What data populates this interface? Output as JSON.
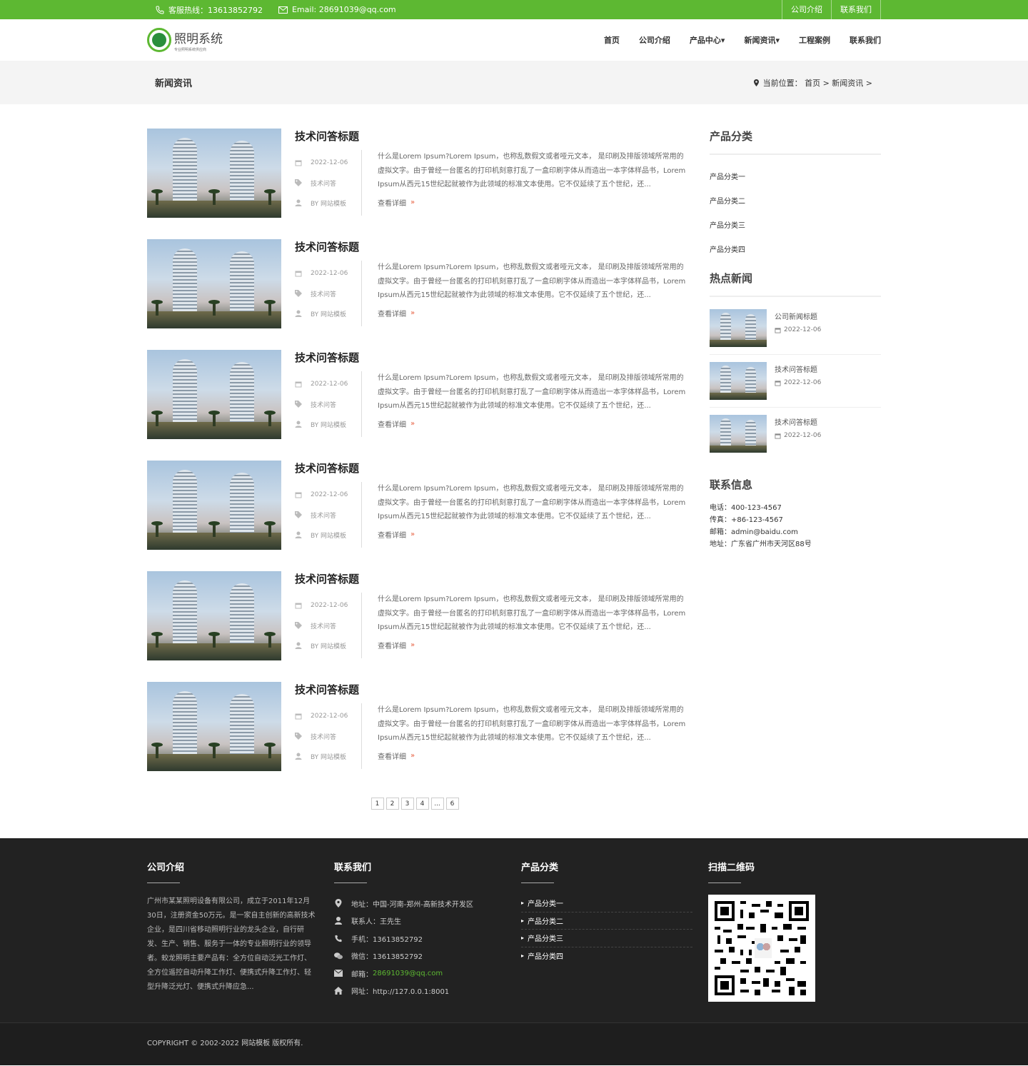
{
  "topbar": {
    "hotline": "客服热线：13613852792",
    "email": "Email: 28691039@qq.com",
    "links": [
      "公司介绍",
      "联系我们"
    ]
  },
  "header": {
    "logo_title": "照明系统",
    "logo_sub": "专业照明系统供应商",
    "nav": [
      "首页",
      "公司介绍",
      "产品中心▾",
      "新闻资讯▾",
      "工程案例",
      "联系我们"
    ]
  },
  "banner": {
    "title": "新闻资讯",
    "crumb": "当前位置： 首页 > 新闻资讯 >"
  },
  "articles": [
    {
      "title": "技术问答标题",
      "date": "2022-12-06",
      "tag": "技术问答",
      "author": "BY 网站模板",
      "excerpt": "什么是Lorem Ipsum?Lorem Ipsum，也称乱数假文或者哑元文本， 是印刷及排版领域所常用的虚拟文字。由于曾经一台匿名的打印机刻意打乱了一盒印刷字体从而造出一本字体样品书，Lorem Ipsum从西元15世纪起就被作为此领域的标准文本使用。它不仅延续了五个世纪，还...",
      "more": "查看详细"
    },
    {
      "title": "技术问答标题",
      "date": "2022-12-06",
      "tag": "技术问答",
      "author": "BY 网站模板",
      "excerpt": "什么是Lorem Ipsum?Lorem Ipsum，也称乱数假文或者哑元文本， 是印刷及排版领域所常用的虚拟文字。由于曾经一台匿名的打印机刻意打乱了一盒印刷字体从而造出一本字体样品书，Lorem Ipsum从西元15世纪起就被作为此领域的标准文本使用。它不仅延续了五个世纪，还...",
      "more": "查看详细"
    },
    {
      "title": "技术问答标题",
      "date": "2022-12-06",
      "tag": "技术问答",
      "author": "BY 网站模板",
      "excerpt": "什么是Lorem Ipsum?Lorem Ipsum，也称乱数假文或者哑元文本， 是印刷及排版领域所常用的虚拟文字。由于曾经一台匿名的打印机刻意打乱了一盒印刷字体从而造出一本字体样品书，Lorem Ipsum从西元15世纪起就被作为此领域的标准文本使用。它不仅延续了五个世纪，还...",
      "more": "查看详细"
    },
    {
      "title": "技术问答标题",
      "date": "2022-12-06",
      "tag": "技术问答",
      "author": "BY 网站模板",
      "excerpt": "什么是Lorem Ipsum?Lorem Ipsum，也称乱数假文或者哑元文本， 是印刷及排版领域所常用的虚拟文字。由于曾经一台匿名的打印机刻意打乱了一盒印刷字体从而造出一本字体样品书，Lorem Ipsum从西元15世纪起就被作为此领域的标准文本使用。它不仅延续了五个世纪，还...",
      "more": "查看详细"
    },
    {
      "title": "技术问答标题",
      "date": "2022-12-06",
      "tag": "技术问答",
      "author": "BY 网站模板",
      "excerpt": "什么是Lorem Ipsum?Lorem Ipsum，也称乱数假文或者哑元文本， 是印刷及排版领域所常用的虚拟文字。由于曾经一台匿名的打印机刻意打乱了一盒印刷字体从而造出一本字体样品书，Lorem Ipsum从西元15世纪起就被作为此领域的标准文本使用。它不仅延续了五个世纪，还...",
      "more": "查看详细"
    },
    {
      "title": "技术问答标题",
      "date": "2022-12-06",
      "tag": "技术问答",
      "author": "BY 网站模板",
      "excerpt": "什么是Lorem Ipsum?Lorem Ipsum，也称乱数假文或者哑元文本， 是印刷及排版领域所常用的虚拟文字。由于曾经一台匿名的打印机刻意打乱了一盒印刷字体从而造出一本字体样品书，Lorem Ipsum从西元15世纪起就被作为此领域的标准文本使用。它不仅延续了五个世纪，还...",
      "more": "查看详细"
    }
  ],
  "pager": [
    "1",
    "2",
    "3",
    "4",
    "...",
    "6"
  ],
  "sidebar": {
    "cat_title": "产品分类",
    "cats": [
      "产品分类一",
      "产品分类二",
      "产品分类三",
      "产品分类四"
    ],
    "hot_title": "热点新闻",
    "hot": [
      {
        "title": "公司新闻标题",
        "date": "2022-12-06"
      },
      {
        "title": "技术问答标题",
        "date": "2022-12-06"
      },
      {
        "title": "技术问答标题",
        "date": "2022-12-06"
      }
    ],
    "contact_title": "联系信息",
    "contact": [
      "电话：400-123-4567",
      "传真：+86-123-4567",
      "邮箱：admin@baidu.com",
      "地址：广东省广州市天河区88号"
    ]
  },
  "footer": {
    "about_title": "公司介绍",
    "about": "广州市某某照明设备有限公司，成立于2011年12月30日，注册资金50万元。是一家自主创新的高新技术企业，是四川省移动照明行业的龙头企业，自行研发、生产、销售、服务于一体的专业照明行业的领导者。蛟龙照明主要产品有：全方位自动泛光工作灯、全方位遥控自动升降工作灯、便携式升降工作灯、轻型升降泛光灯、便携式升降应急...",
    "contact_title": "联系我们",
    "address": "地址：中国-河南-郑州-高新技术开发区",
    "person": "联系人：王先生",
    "phone": "手机：13613852792",
    "wechat": "微信：13613852792",
    "email_label": "邮箱：",
    "email": "28691039@qq.com",
    "site": "网址：http://127.0.0.1:8001",
    "cat_title": "产品分类",
    "cats": [
      "产品分类一",
      "产品分类二",
      "产品分类三",
      "产品分类四"
    ],
    "qr_title": "扫描二维码",
    "copyright": "COPYRIGHT © 2002-2022 网站模板 版权所有."
  },
  "colors": {
    "accent": "#5db832",
    "footer_bg": "#222222",
    "more_arrow": "#e65a3a"
  }
}
